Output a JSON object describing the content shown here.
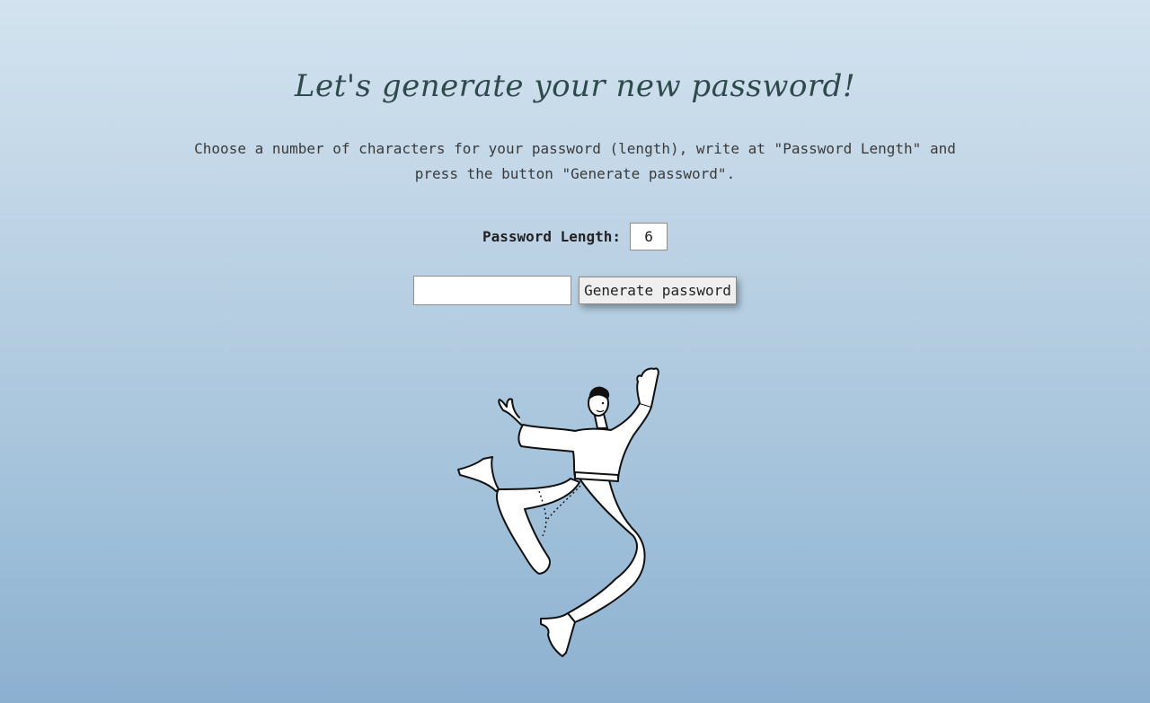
{
  "header": {
    "title": "Let's generate your new password!"
  },
  "instructions": {
    "text": "Choose a number of characters for your password (length), write at \"Password Length\" and press the button \"Generate password\"."
  },
  "form": {
    "length_label": "Password Length:",
    "length_value": "6",
    "password_output_value": "",
    "generate_button_label": "Generate password"
  },
  "illustration": {
    "icon": "jumping-person-illustration"
  },
  "colors": {
    "background_top": "#d3e3ef",
    "background_bottom": "#8bb0cf",
    "title": "#2f4a4c"
  }
}
